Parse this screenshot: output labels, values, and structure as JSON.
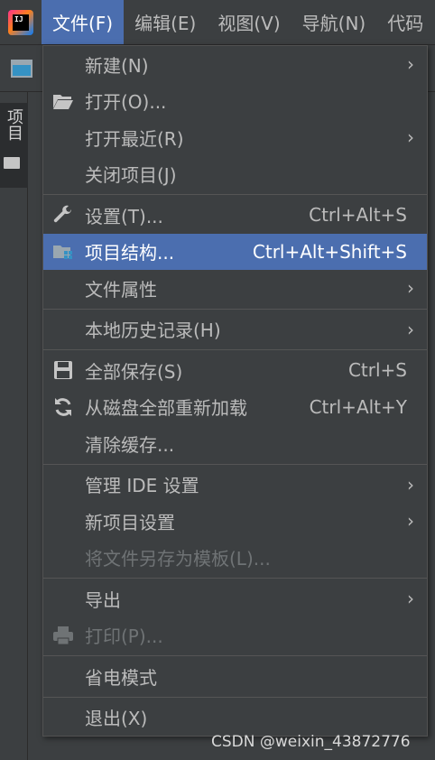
{
  "menubar": {
    "logo_text": "IJ",
    "items": [
      {
        "label": "文件(F)",
        "active": true
      },
      {
        "label": "编辑(E)",
        "active": false
      },
      {
        "label": "视图(V)",
        "active": false
      },
      {
        "label": "导航(N)",
        "active": false
      },
      {
        "label": "代码",
        "active": false
      }
    ]
  },
  "side": {
    "project_tab_label": "项目"
  },
  "peek": {
    "left_1": "",
    "left_2": "",
    "right_1": ""
  },
  "file_menu": {
    "new": "新建(N)",
    "open": "打开(O)...",
    "open_recent": "打开最近(R)",
    "close_project": "关闭项目(J)",
    "settings": "设置(T)...",
    "settings_shortcut": "Ctrl+Alt+S",
    "project_structure": "项目结构...",
    "project_structure_shortcut": "Ctrl+Alt+Shift+S",
    "file_properties": "文件属性",
    "local_history": "本地历史记录(H)",
    "save_all": "全部保存(S)",
    "save_all_shortcut": "Ctrl+S",
    "reload_all": "从磁盘全部重新加载",
    "reload_all_shortcut": "Ctrl+Alt+Y",
    "invalidate_caches": "清除缓存...",
    "manage_ide_settings": "管理 IDE 设置",
    "new_project_settings": "新项目设置",
    "save_as_template": "将文件另存为模板(L)...",
    "export": "导出",
    "print": "打印(P)...",
    "power_save": "省电模式",
    "exit": "退出(X)"
  },
  "watermark": "CSDN @weixin_43872776",
  "colors": {
    "background": "#3c3f41",
    "highlight": "#4b6eaf",
    "text": "#bbbbbb",
    "disabled_text": "#6f7375"
  }
}
